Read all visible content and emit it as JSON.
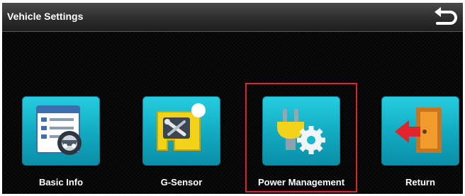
{
  "header": {
    "title": "Vehicle Settings",
    "back_icon": "back-arrow-icon"
  },
  "menu": {
    "items": [
      {
        "label": "Basic Info",
        "icon": "vehicle-info-icon"
      },
      {
        "label": "G-Sensor",
        "icon": "g-sensor-tools-icon"
      },
      {
        "label": "Power Management",
        "icon": "power-plug-gear-icon",
        "selected": true
      },
      {
        "label": "Return",
        "icon": "exit-door-icon"
      }
    ]
  },
  "colors": {
    "tile": "#17b8cf",
    "highlight": "#d7262b",
    "background": "#050505"
  }
}
